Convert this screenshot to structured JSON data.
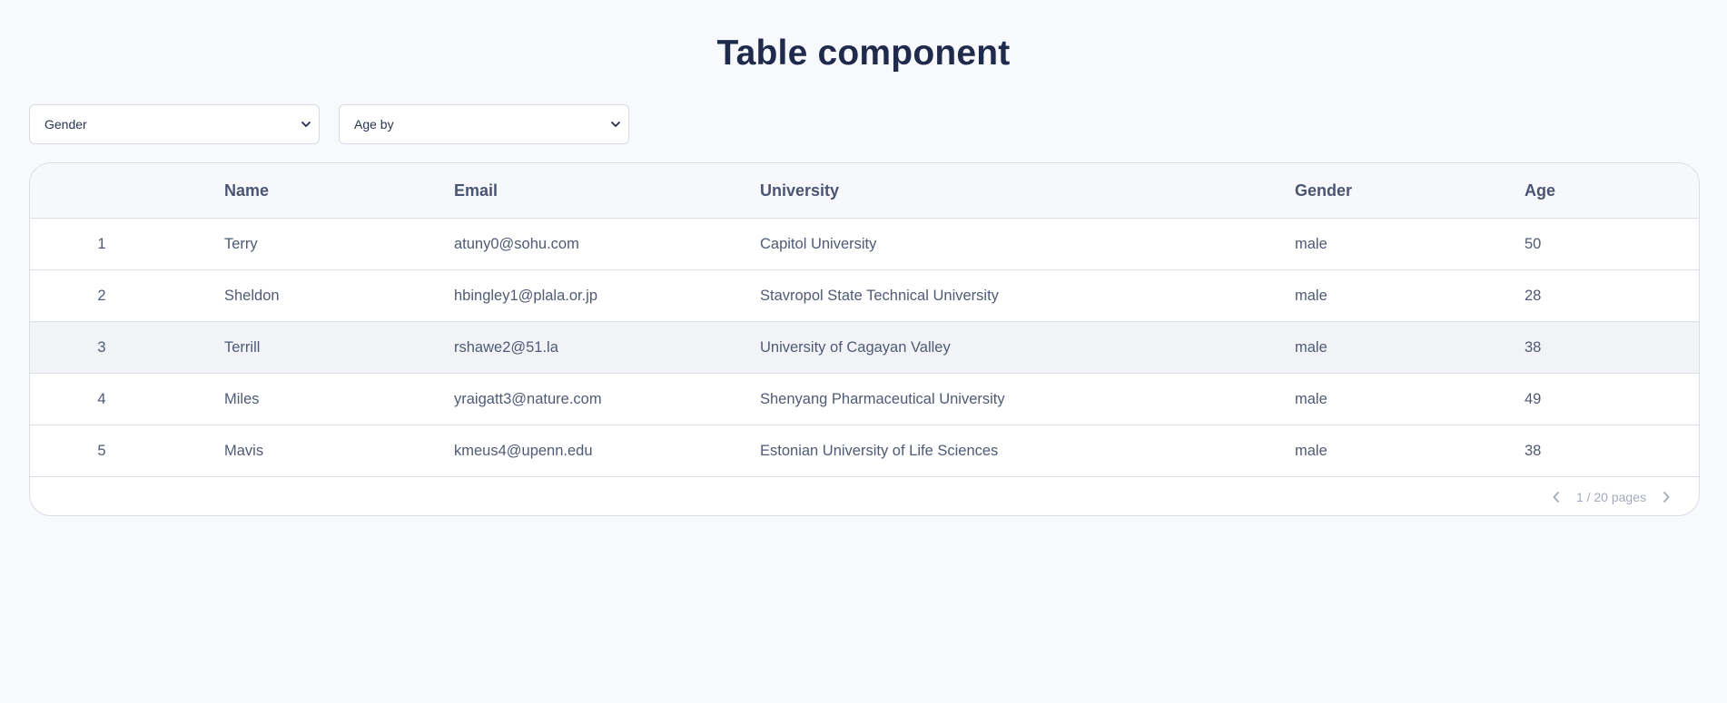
{
  "page": {
    "title": "Table component"
  },
  "filters": {
    "gender": {
      "selected": "Gender"
    },
    "age": {
      "selected": "Age by"
    }
  },
  "table": {
    "columns": [
      "",
      "Name",
      "Email",
      "University",
      "Gender",
      "Age"
    ],
    "rows": [
      {
        "index": "1",
        "name": "Terry",
        "email": "atuny0@sohu.com",
        "university": "Capitol University",
        "gender": "male",
        "age": "50"
      },
      {
        "index": "2",
        "name": "Sheldon",
        "email": "hbingley1@plala.or.jp",
        "university": "Stavropol State Technical University",
        "gender": "male",
        "age": "28"
      },
      {
        "index": "3",
        "name": "Terrill",
        "email": "rshawe2@51.la",
        "university": "University of Cagayan Valley",
        "gender": "male",
        "age": "38"
      },
      {
        "index": "4",
        "name": "Miles",
        "email": "yraigatt3@nature.com",
        "university": "Shenyang Pharmaceutical University",
        "gender": "male",
        "age": "49"
      },
      {
        "index": "5",
        "name": "Mavis",
        "email": "kmeus4@upenn.edu",
        "university": "Estonian University of Life Sciences",
        "gender": "male",
        "age": "38"
      }
    ],
    "hovered_row": 3
  },
  "pagination": {
    "label": "1 / 20 pages",
    "prev_icon": "chevron-left-icon",
    "next_icon": "chevron-right-icon"
  },
  "colors": {
    "background": "#f7f9fc",
    "title": "#1f2a4d",
    "text": "#4f5a75",
    "border": "#dcdfe6",
    "hover_row": "#f2f3f6"
  }
}
